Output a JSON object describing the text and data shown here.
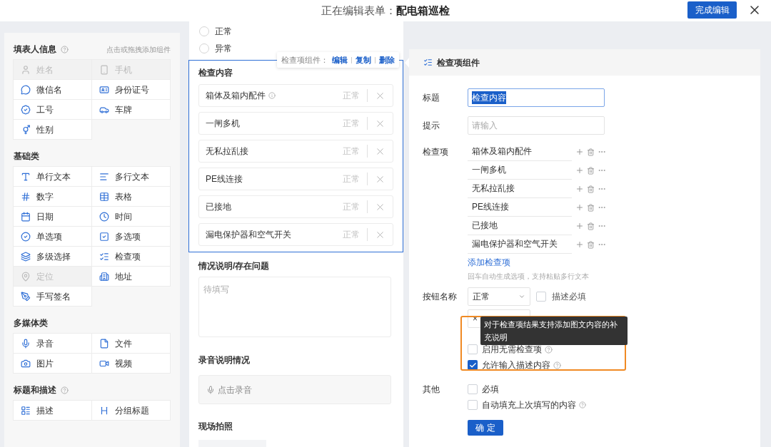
{
  "header": {
    "prefix": "正在编辑表单：",
    "form_name": "配电箱巡检",
    "done_button": "完成编辑"
  },
  "palette": {
    "hint": "点击或拖拽添加组件",
    "groups": [
      {
        "title": "填表人信息",
        "help": true,
        "items": [
          {
            "label": "姓名",
            "disabled": true
          },
          {
            "label": "手机",
            "disabled": true
          },
          {
            "label": "微信名",
            "disabled": false
          },
          {
            "label": "身份证号",
            "disabled": false
          },
          {
            "label": "工号",
            "disabled": false
          },
          {
            "label": "车牌",
            "disabled": false
          },
          {
            "label": "性别",
            "disabled": false
          }
        ]
      },
      {
        "title": "基础类",
        "help": false,
        "items": [
          {
            "label": "单行文本",
            "disabled": false
          },
          {
            "label": "多行文本",
            "disabled": false
          },
          {
            "label": "数字",
            "disabled": false
          },
          {
            "label": "表格",
            "disabled": false
          },
          {
            "label": "日期",
            "disabled": false
          },
          {
            "label": "时间",
            "disabled": false
          },
          {
            "label": "单选项",
            "disabled": false
          },
          {
            "label": "多选项",
            "disabled": false
          },
          {
            "label": "多级选择",
            "disabled": false
          },
          {
            "label": "检查项",
            "disabled": false
          },
          {
            "label": "定位",
            "disabled": true
          },
          {
            "label": "地址",
            "disabled": false
          },
          {
            "label": "手写签名",
            "disabled": false
          }
        ]
      },
      {
        "title": "多媒体类",
        "help": false,
        "items": [
          {
            "label": "录音",
            "disabled": false
          },
          {
            "label": "文件",
            "disabled": false
          },
          {
            "label": "图片",
            "disabled": false
          },
          {
            "label": "视频",
            "disabled": false
          }
        ]
      },
      {
        "title": "标题和描述",
        "help": true,
        "items": [
          {
            "label": "描述",
            "disabled": false
          },
          {
            "label": "分组标题",
            "disabled": false
          }
        ]
      }
    ]
  },
  "form": {
    "radios": [
      {
        "label": "正常",
        "selected": false
      },
      {
        "label": "异常",
        "selected": false
      }
    ],
    "check_block": {
      "selected": true,
      "toolbar_label": "检查项组件：",
      "actions": [
        "编辑",
        "复制",
        "删除"
      ],
      "title": "检查内容",
      "items": [
        {
          "label": "箱体及箱内配件",
          "info": true,
          "status": "正常"
        },
        {
          "label": "一闸多机",
          "info": false,
          "status": "正常"
        },
        {
          "label": "无私拉乱接",
          "info": false,
          "status": "正常"
        },
        {
          "label": "PE线连接",
          "info": false,
          "status": "正常"
        },
        {
          "label": "已接地",
          "info": false,
          "status": "正常"
        },
        {
          "label": "漏电保护器和空气开关",
          "info": false,
          "status": "正常"
        }
      ]
    },
    "description_field": {
      "label": "情况说明/存在问题",
      "placeholder": "待填写"
    },
    "recording": {
      "label": "录音说明情况",
      "button": "点击录音"
    },
    "photo": {
      "label": "现场拍照"
    }
  },
  "inspector": {
    "title": "检查项组件",
    "title_label": "标题",
    "title_value": "检查内容",
    "hint_label": "提示",
    "hint_placeholder": "请输入",
    "items_label": "检查项",
    "items": [
      "箱体及箱内配件",
      "一闸多机",
      "无私拉乱接",
      "PE线连接",
      "已接地",
      "漏电保护器和空气开关"
    ],
    "add_link": "添加检查项",
    "add_hint": "回车自动生成选项，支持粘贴多行文本",
    "buttons_label": "按钮名称",
    "button_rows": [
      {
        "value": "正常",
        "check_label": "描述必填",
        "checked": false
      },
      {
        "value": "×"
      }
    ],
    "options": [
      {
        "label": "启用无需检查项",
        "checked": false,
        "help": true
      },
      {
        "label": "允许输入描述内容",
        "checked": true,
        "help": true
      }
    ],
    "tooltip": "对于检查项结果支持添加图文内容的补充说明",
    "other_label": "其他",
    "other_options": [
      {
        "label": "必填",
        "checked": false,
        "help": false
      },
      {
        "label": "自动填充上次填写的内容",
        "checked": false,
        "help": true
      }
    ],
    "confirm": "确 定"
  }
}
